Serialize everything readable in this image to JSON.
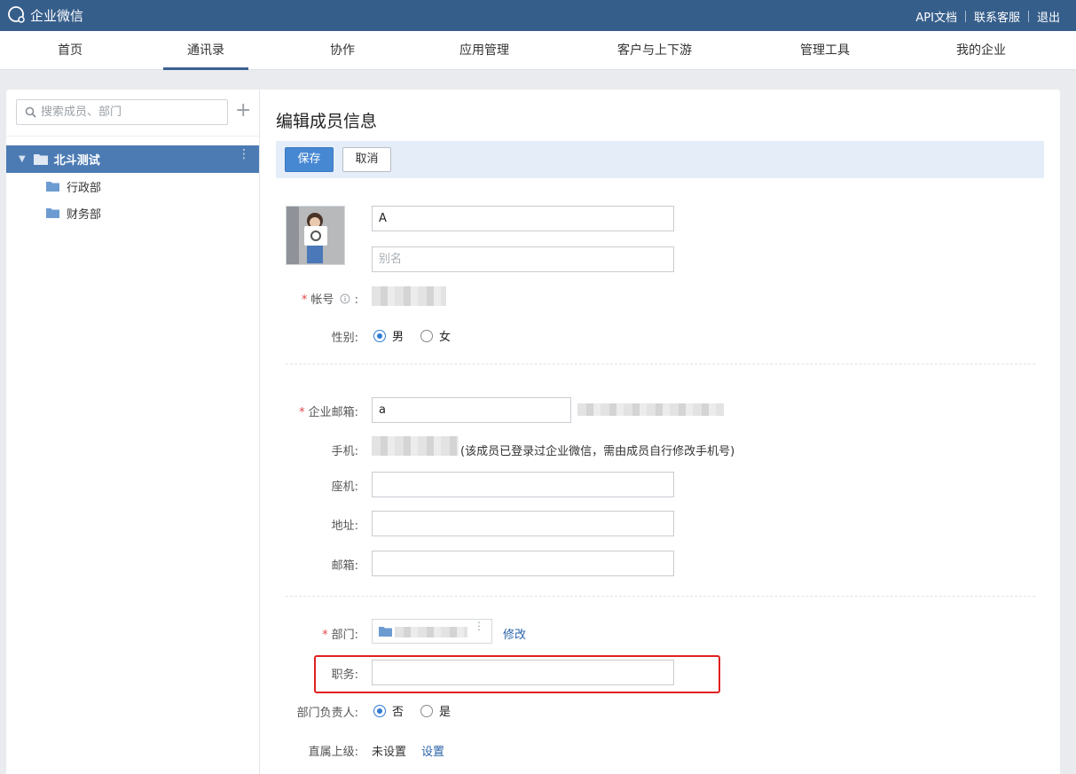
{
  "topbar": {
    "logo_text": "企业微信",
    "links": [
      "API文档",
      "联系客服",
      "退出"
    ]
  },
  "nav": {
    "items": [
      "首页",
      "通讯录",
      "协作",
      "应用管理",
      "客户与上下游",
      "管理工具",
      "我的企业"
    ],
    "active_index": 1
  },
  "sidebar": {
    "search_placeholder": "搜索成员、部门",
    "root": "北斗测试",
    "children": [
      "行政部",
      "财务部"
    ]
  },
  "form": {
    "title": "编辑成员信息",
    "save_label": "保存",
    "cancel_label": "取消",
    "name_value": "A",
    "alias_placeholder": "别名",
    "account_label": "帐号",
    "gender_label": "性别:",
    "gender_male": "男",
    "gender_female": "女",
    "email_label": "企业邮箱:",
    "email_value": "a",
    "mobile_label": "手机:",
    "mobile_note": "(该成员已登录过企业微信，需由成员自行修改手机号)",
    "landline_label": "座机:",
    "address_label": "地址:",
    "mailbox_label": "邮箱:",
    "department_label": "部门:",
    "modify_label": "修改",
    "position_label": "职务:",
    "leader_label": "部门负责人:",
    "leader_no": "否",
    "leader_yes": "是",
    "supervisor_label": "直属上级:",
    "supervisor_value": "未设置",
    "supervisor_set": "设置",
    "colon": ":",
    "required_mark": "*",
    "more_glyph": "⋮",
    "plus_glyph": "+",
    "tree_toggle": "▼"
  },
  "colors": {
    "topbar": "#365e8b",
    "accent": "#4788d3",
    "tree_selected": "#4c7bb4",
    "highlight": "#e02020"
  }
}
